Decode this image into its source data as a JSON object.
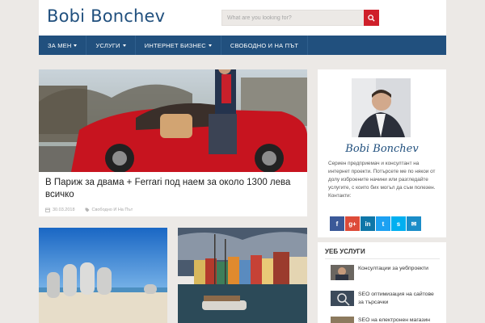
{
  "site": {
    "title": "Bobi Bonchev"
  },
  "search": {
    "placeholder": "What are you looking for?"
  },
  "nav": {
    "items": [
      {
        "label": "За мен",
        "dropdown": true
      },
      {
        "label": "Услуги",
        "dropdown": true
      },
      {
        "label": "Интернет бизнес",
        "dropdown": true
      },
      {
        "label": "Свободно и на път",
        "dropdown": false
      }
    ]
  },
  "featured": {
    "title": "В Париж за двама + Ferrari под наем за около 1300 лева всичко",
    "date": "30.03.2018",
    "category": "Свободно И На Път"
  },
  "profile": {
    "signature": "Bobi Bonchev",
    "bio": "Сериен предприемач и консултант на интернет проекти. Потърсете ме по някои от долу изброените начини или разгледайте услугите, с които бих могъл да съм полезен. Контакти:"
  },
  "social": [
    {
      "icon": "facebook-icon",
      "glyph": "f",
      "color": "#3b5998"
    },
    {
      "icon": "google-plus-icon",
      "glyph": "g+",
      "color": "#dd4b39"
    },
    {
      "icon": "linkedin-icon",
      "glyph": "in",
      "color": "#0e76a8"
    },
    {
      "icon": "twitter-icon",
      "glyph": "t",
      "color": "#1da1f2"
    },
    {
      "icon": "skype-icon",
      "glyph": "s",
      "color": "#00aff0"
    },
    {
      "icon": "email-icon",
      "glyph": "✉",
      "color": "#1b8dc8"
    }
  ],
  "services": {
    "title": "Уеб услуги",
    "items": [
      {
        "label": "Консултации за уебпроекти"
      },
      {
        "label": "SEO оптимизация на сайтове за търсачки"
      },
      {
        "label": "SEO на електронен магазин"
      }
    ]
  },
  "colors": {
    "brand": "#21507e",
    "accent": "#cf1f2a",
    "background": "#ece9e6"
  }
}
